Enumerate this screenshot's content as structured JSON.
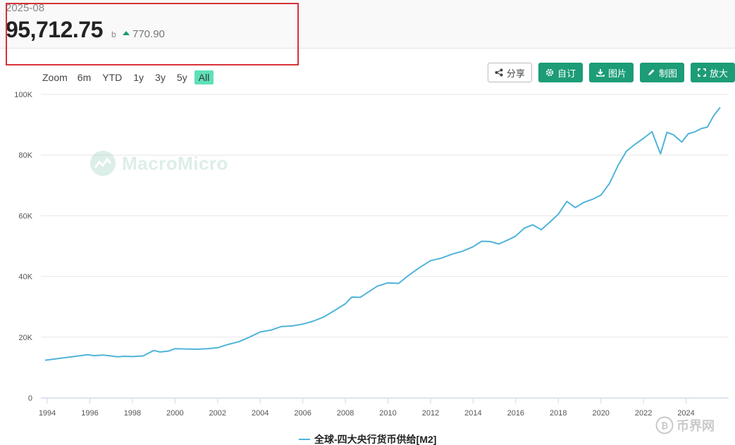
{
  "header": {
    "date": "2025-08",
    "value": "95,712.75",
    "unit": "b",
    "change": "770.90"
  },
  "zoom": {
    "label": "Zoom",
    "buttons": [
      "6m",
      "YTD",
      "1y",
      "3y",
      "5y",
      "All"
    ],
    "active": "All"
  },
  "toolbar": {
    "share": "分享",
    "custom": "自订",
    "image": "图片",
    "draw": "制图",
    "expand": "放大"
  },
  "watermark": "MacroMicro",
  "logo": "币界网",
  "colors": {
    "line": "#4fb4d8",
    "accent": "#1c9c77",
    "highlight": "#d7323a",
    "up": "#1a9a74"
  },
  "chart_data": {
    "type": "line",
    "title": "",
    "xlabel": "",
    "ylabel": "",
    "xlim": [
      1993.7,
      2026.0
    ],
    "ylim": [
      0,
      100000
    ],
    "x_ticks": [
      "1994",
      "1996",
      "1998",
      "2000",
      "2002",
      "2004",
      "2006",
      "2008",
      "2010",
      "2012",
      "2014",
      "2016",
      "2018",
      "2020",
      "2022",
      "2024"
    ],
    "y_ticks": [
      "0",
      "20K",
      "40K",
      "60K",
      "80K",
      "100K"
    ],
    "grid": true,
    "legend": "bottom-center",
    "series": [
      {
        "name": "全球-四大央行货币供给[M2]",
        "x": [
          1993.9,
          1995.9,
          1996.2,
          1996.6,
          1997.0,
          1997.3,
          1997.6,
          1998.0,
          1998.5,
          1999.0,
          1999.3,
          1999.7,
          2000.0,
          2000.5,
          2001.0,
          2001.5,
          2002.0,
          2002.5,
          2003.0,
          2003.5,
          2004.0,
          2004.5,
          2005.0,
          2005.5,
          2006.0,
          2006.5,
          2007.0,
          2007.5,
          2008.0,
          2008.3,
          2008.7,
          2009.0,
          2009.5,
          2010.0,
          2010.5,
          2011.0,
          2011.5,
          2012.0,
          2012.5,
          2013.0,
          2013.5,
          2014.0,
          2014.4,
          2014.8,
          2015.2,
          2015.6,
          2016.0,
          2016.4,
          2016.8,
          2017.2,
          2017.6,
          2018.0,
          2018.4,
          2018.8,
          2019.2,
          2019.6,
          2020.0,
          2020.4,
          2020.8,
          2021.2,
          2021.6,
          2022.0,
          2022.4,
          2022.8,
          2023.1,
          2023.4,
          2023.8,
          2024.1,
          2024.4,
          2024.7,
          2025.0,
          2025.3,
          2025.6
        ],
        "values": [
          12400,
          14200,
          13900,
          14100,
          13800,
          13500,
          13700,
          13600,
          13800,
          15600,
          15100,
          15400,
          16200,
          16100,
          16000,
          16200,
          16500,
          17600,
          18500,
          20000,
          21700,
          22300,
          23500,
          23700,
          24300,
          25300,
          26700,
          28800,
          31000,
          33200,
          33100,
          34500,
          36800,
          37900,
          37700,
          40500,
          43000,
          45200,
          46000,
          47300,
          48300,
          49800,
          51600,
          51500,
          50700,
          51900,
          53300,
          55900,
          57000,
          55400,
          57900,
          60500,
          64700,
          62700,
          64400,
          65400,
          66800,
          70600,
          76500,
          81300,
          83500,
          85500,
          87700,
          80400,
          87500,
          86700,
          84300,
          87000,
          87600,
          88700,
          89200,
          93000,
          95700
        ]
      }
    ]
  }
}
